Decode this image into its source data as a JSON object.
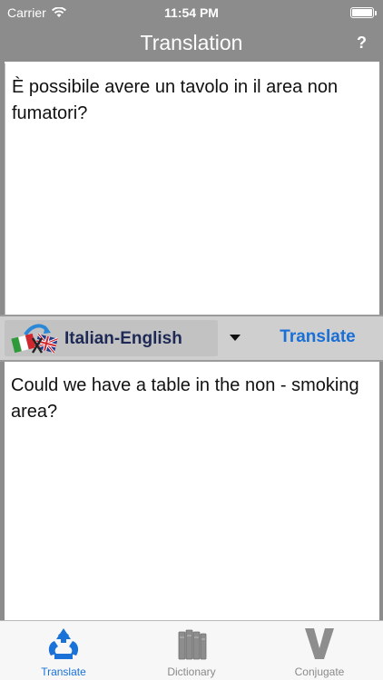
{
  "status_bar": {
    "carrier": "Carrier",
    "time": "11:54 PM",
    "wifi_icon": "wifi-icon",
    "battery_icon": "battery-icon"
  },
  "nav": {
    "title": "Translation",
    "help_label": "?"
  },
  "source": {
    "text": "È possibile avere un tavolo in il area non fumatori?"
  },
  "language_bar": {
    "flags_icon": "italy-uk-flags-icon",
    "language_pair": "Italian-English",
    "translate_label": "Translate"
  },
  "result": {
    "text": "Could we have a table in the non - smoking area?"
  },
  "tabs": [
    {
      "label": "Translate",
      "icon": "translate-recycle-icon",
      "active": true
    },
    {
      "label": "Dictionary",
      "icon": "books-icon",
      "active": false
    },
    {
      "label": "Conjugate",
      "icon": "letter-v-icon",
      "active": false
    }
  ],
  "colors": {
    "chrome": "#8c8c8c",
    "accent": "#1a6fd6",
    "language_text": "#1e2a55"
  }
}
